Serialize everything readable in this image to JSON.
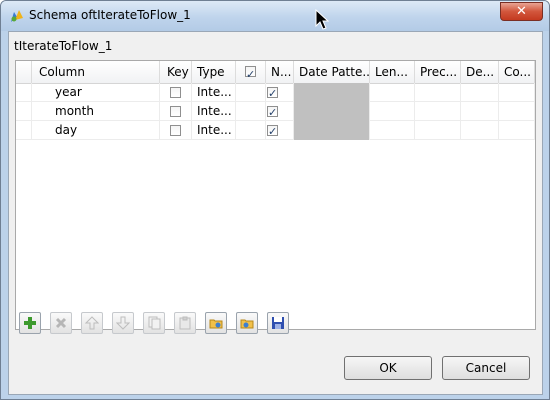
{
  "window": {
    "title": "Schema oftIterateToFlow_1",
    "close_glyph": "✕"
  },
  "component_label": "tIterateToFlow_1",
  "table": {
    "header_check_glyph": "✓",
    "columns": [
      "Column",
      "Key",
      "Type",
      "",
      "N...",
      "Date Patte...",
      "Len...",
      "Prec...",
      "De...",
      "Co..."
    ],
    "rows": [
      {
        "column": "year",
        "key": false,
        "type": "Inte...",
        "nullable": true
      },
      {
        "column": "month",
        "key": false,
        "type": "Inte...",
        "nullable": true
      },
      {
        "column": "day",
        "key": false,
        "type": "Inte...",
        "nullable": true
      }
    ]
  },
  "toolbar": {
    "icons": [
      "add-icon",
      "remove-icon",
      "move-up-icon",
      "move-down-icon",
      "copy-icon",
      "paste-icon",
      "import-icon",
      "export-icon",
      "save-icon"
    ]
  },
  "buttons": {
    "ok_label": "OK",
    "cancel_label": "Cancel"
  },
  "colors": {
    "titlebar": "#bfd4ec",
    "close_button": "#c43a20",
    "dialog_bg": "#f0f0f0",
    "date_pattern_cell": "#c0c0c0"
  }
}
